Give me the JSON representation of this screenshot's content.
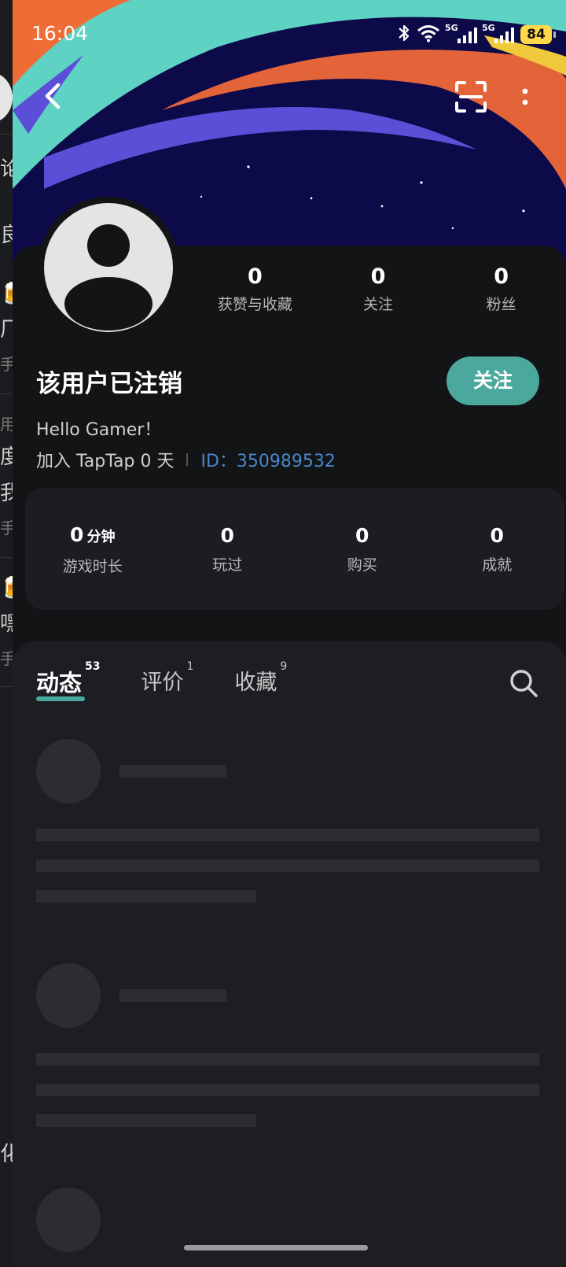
{
  "status_bar": {
    "time": "16:04",
    "network_labels": [
      "5G",
      "5G"
    ],
    "battery": "84",
    "icons": [
      "bluetooth-icon",
      "wifi-icon",
      "signal-icon",
      "signal-icon",
      "battery-icon"
    ]
  },
  "nav": {
    "back_icon": "chevron-left-icon",
    "scan_icon": "scan-icon",
    "more_icon": "more-vertical-icon"
  },
  "colors": {
    "accent": "#4aa99c",
    "link": "#4a86c9",
    "background": "#131416",
    "card": "#1c1d22",
    "battery": "#ffd84a"
  },
  "profile": {
    "stats": [
      {
        "value": "0",
        "label": "获赞与收藏"
      },
      {
        "value": "0",
        "label": "关注"
      },
      {
        "value": "0",
        "label": "粉丝"
      }
    ],
    "username": "该用户已注销",
    "follow_label": "关注",
    "bio": "Hello Gamer！",
    "joined": "加入 TapTap 0 天",
    "id_text": "ID：350989532"
  },
  "game_stats": [
    {
      "value": "0",
      "unit": "分钟",
      "label": "游戏时长"
    },
    {
      "value": "0",
      "unit": "",
      "label": "玩过"
    },
    {
      "value": "0",
      "unit": "",
      "label": "购买"
    },
    {
      "value": "0",
      "unit": "",
      "label": "成就"
    }
  ],
  "tabs": [
    {
      "label": "动态",
      "count": "53",
      "active": true
    },
    {
      "label": "评价",
      "count": "1",
      "active": false
    },
    {
      "label": "收藏",
      "count": "9",
      "active": false
    }
  ],
  "background_page": {
    "fragments": [
      "论",
      "良",
      "🍺",
      "厂",
      "手",
      "用",
      "度",
      "我",
      "手",
      "🍺",
      "嘿",
      "手",
      "化"
    ]
  }
}
